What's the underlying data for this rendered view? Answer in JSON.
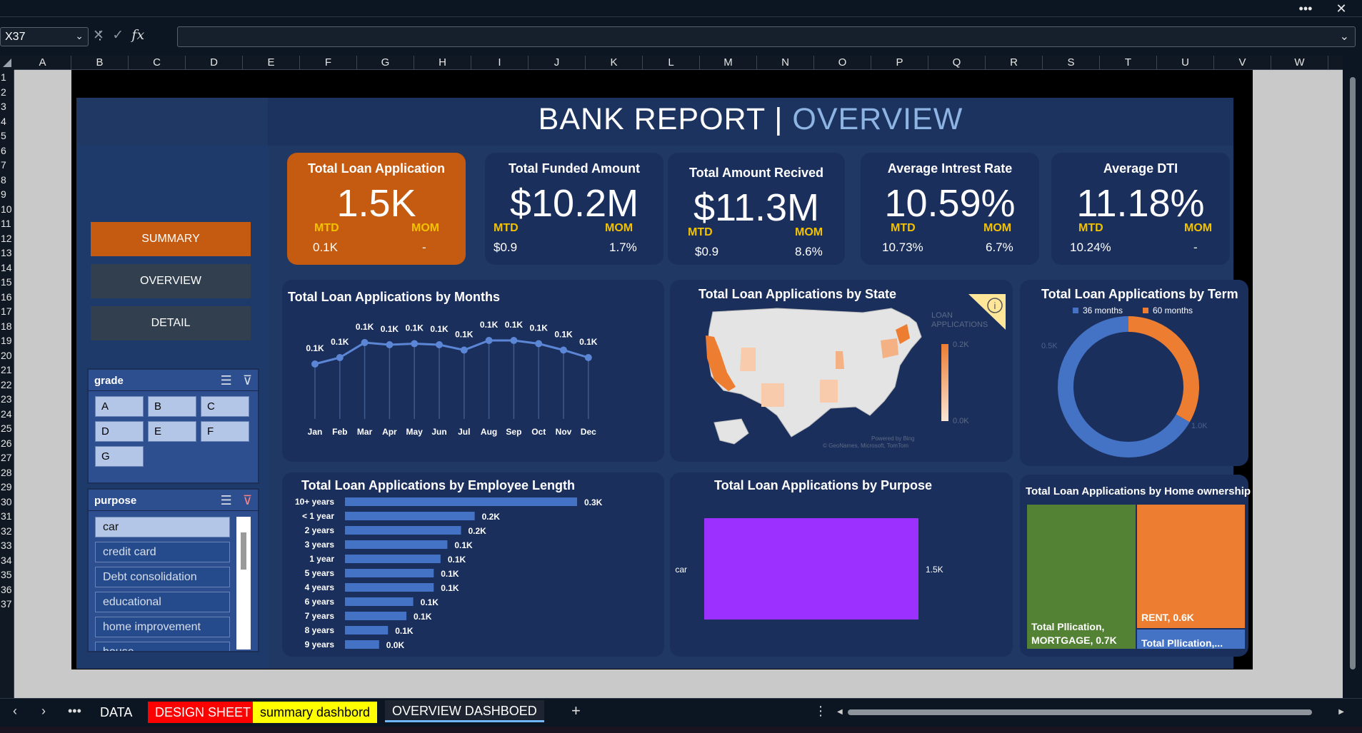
{
  "namebox": "X37",
  "formula_icons": [
    "✕",
    "✓",
    "fx"
  ],
  "columns": [
    "A",
    "B",
    "C",
    "D",
    "E",
    "F",
    "G",
    "H",
    "I",
    "J",
    "K",
    "L",
    "M",
    "N",
    "O",
    "P",
    "Q",
    "R",
    "S",
    "T",
    "U",
    "V",
    "W"
  ],
  "rows": [
    "1",
    "2",
    "3",
    "4",
    "5",
    "6",
    "7",
    "8",
    "9",
    "10",
    "11",
    "12",
    "13",
    "14",
    "15",
    "16",
    "17",
    "18",
    "19",
    "20",
    "21",
    "22",
    "23",
    "24",
    "25",
    "26",
    "27",
    "28",
    "29",
    "30",
    "31",
    "32",
    "33",
    "34",
    "35",
    "36",
    "37"
  ],
  "header": {
    "title": "BANK REPORT | ",
    "subtitle": "OVERVIEW"
  },
  "nav": {
    "summary": "SUMMARY",
    "overview": "OVERVIEW",
    "detail": "DETAIL"
  },
  "grade_slicer": {
    "title": "grade",
    "items": [
      "A",
      "B",
      "C",
      "D",
      "E",
      "F",
      "G"
    ]
  },
  "purpose_slicer": {
    "title": "purpose",
    "items": [
      "car",
      "credit card",
      "Debt consolidation",
      "educational",
      "home improvement",
      "house"
    ]
  },
  "kpis": [
    {
      "label": "Total Loan Application",
      "value": "1.5K",
      "mtd_label": "MTD",
      "mom_label": "MOM",
      "mtd": "0.1K",
      "mom": "-"
    },
    {
      "label": "Total Funded Amount",
      "value": "$10.2M",
      "mtd_label": "MTD",
      "mom_label": "MOM",
      "mtd": "$0.9",
      "mom": "1.7%"
    },
    {
      "label": "Total Amount Recived",
      "value": "$11.3M",
      "mtd_label": "MTD",
      "mom_label": "MOM",
      "mtd": "$0.9",
      "mom": "8.6%"
    },
    {
      "label": "Average Intrest Rate",
      "value": "10.59%",
      "mtd_label": "MTD",
      "mom_label": "MOM",
      "mtd": "10.73%",
      "mom": "6.7%"
    },
    {
      "label": "Average DTI",
      "value": "11.18%",
      "mtd_label": "MTD",
      "mom_label": "MOM",
      "mtd": "10.24%",
      "mom": "-"
    }
  ],
  "charts": {
    "months_title": "Total Loan Applications by Months",
    "state_title": "Total Loan Applications by State",
    "state_legend_title": "LOAN APPLICATIONS",
    "state_legend_max": "0.2K",
    "state_legend_min": "0.0K",
    "state_credit": "Powered by Bing",
    "state_credit2": "© GeoNames, Microsoft, TomTom",
    "term_title": "Total Loan Applications by Term",
    "emp_title": "Total Loan Applications by Employee  Length",
    "purpose_title": "Total Loan Applications by Purpose",
    "home_title": "Total Loan Applications by Home ownership"
  },
  "chart_data": [
    {
      "type": "line",
      "title": "Total Loan Applications by Months",
      "categories": [
        "Jan",
        "Feb",
        "Mar",
        "Apr",
        "May",
        "Jun",
        "Jul",
        "Aug",
        "Sep",
        "Oct",
        "Nov",
        "Dec"
      ],
      "values": [
        0.1,
        0.1,
        0.1,
        0.1,
        0.1,
        0.1,
        0.1,
        0.1,
        0.1,
        0.1,
        0.1,
        0.1
      ],
      "labels": [
        "0.1K",
        "0.1K",
        "0.1K",
        "0.1K",
        "0.1K",
        "0.1K",
        "0.1K",
        "0.1K",
        "0.1K",
        "0.1K",
        "0.1K",
        "0.1K"
      ],
      "relative_values": [
        108,
        114,
        128,
        126,
        127,
        126,
        121,
        130,
        130,
        127,
        121,
        114
      ],
      "color": "#4472c4"
    },
    {
      "type": "pie",
      "title": "Total Loan Applications by Term",
      "series": [
        {
          "name": "36 months",
          "value": 1.0,
          "label": "1.0K",
          "color": "#4472c4"
        },
        {
          "name": "60 months",
          "value": 0.5,
          "label": "0.5K",
          "color": "#ed7d31"
        }
      ]
    },
    {
      "type": "bar",
      "title": "Total Loan Applications by Employee  Length",
      "categories": [
        "10+ years",
        "< 1 year",
        "2 years",
        "3 years",
        "1 year",
        "5 years",
        "4 years",
        "6 years",
        "7 years",
        "8 years",
        "9 years"
      ],
      "values": [
        0.34,
        0.19,
        0.17,
        0.15,
        0.14,
        0.13,
        0.13,
        0.1,
        0.09,
        0.063,
        0.05
      ],
      "labels": [
        "0.3K",
        "0.2K",
        "0.2K",
        "0.1K",
        "0.1K",
        "0.1K",
        "0.1K",
        "0.1K",
        "0.1K",
        "0.1K",
        "0.0K"
      ],
      "color": "#4472c4"
    },
    {
      "type": "bar",
      "title": "Total Loan Applications by Purpose",
      "categories": [
        "car"
      ],
      "values": [
        1.5
      ],
      "labels": [
        "1.5K"
      ],
      "color": "#9b30ff"
    },
    {
      "type": "treemap",
      "title": "Total Loan Applications by Home ownership",
      "series": [
        {
          "name": "MORTGAGE",
          "value": 0.7,
          "label": "Total Pllication, MORTGAGE, 0.7K",
          "color": "#548235"
        },
        {
          "name": "RENT",
          "value": 0.6,
          "label": "RENT, 0.6K",
          "color": "#ed7d31"
        },
        {
          "name": "OWN",
          "value": 0.1,
          "label": "Total Pllication,...",
          "color": "#4472c4"
        }
      ]
    }
  ],
  "sheet_tabs": [
    {
      "label": "DATA",
      "color": ""
    },
    {
      "label": "DESIGN SHEET",
      "color": "#ff0000"
    },
    {
      "label": "summary dashbord",
      "color": "#ffff00"
    },
    {
      "label": "OVERVIEW DASHBOED",
      "color": ""
    }
  ]
}
